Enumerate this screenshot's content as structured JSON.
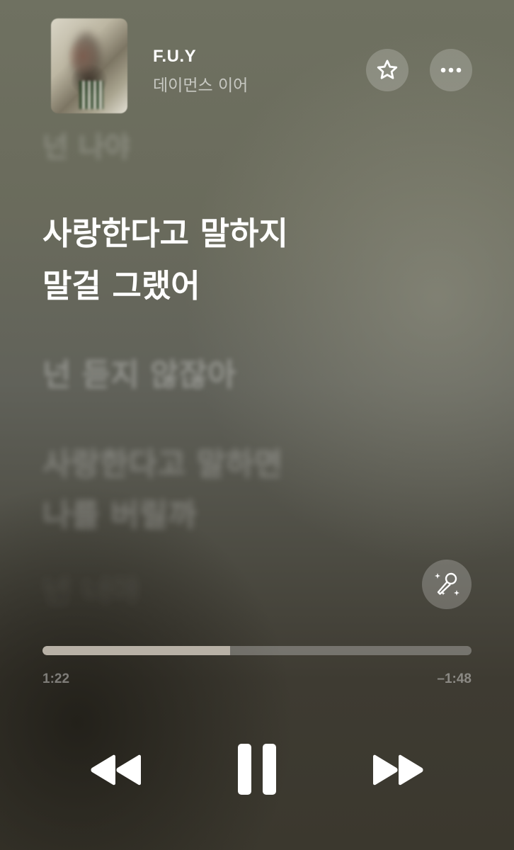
{
  "now_playing": {
    "title": "F.U.Y",
    "artist": "데이먼스 이어",
    "favorite_icon": "star-icon",
    "more_icon": "ellipsis-icon"
  },
  "lyrics": {
    "previous": "넌 나야",
    "current": "사랑한다고 말하지\n말걸 그랬어",
    "next": [
      "넌 듣지 않잖아",
      "사랑한다고 말하면\n나를 버릴까",
      "넌 너야"
    ]
  },
  "sing_button_icon": "microphone-sparkle-icon",
  "playback": {
    "elapsed": "1:22",
    "remaining": "–1:48",
    "progress": 0.437
  },
  "controls": {
    "rewind_icon": "rewind-icon",
    "pause_icon": "pause-icon",
    "forward_icon": "fast-forward-icon"
  }
}
